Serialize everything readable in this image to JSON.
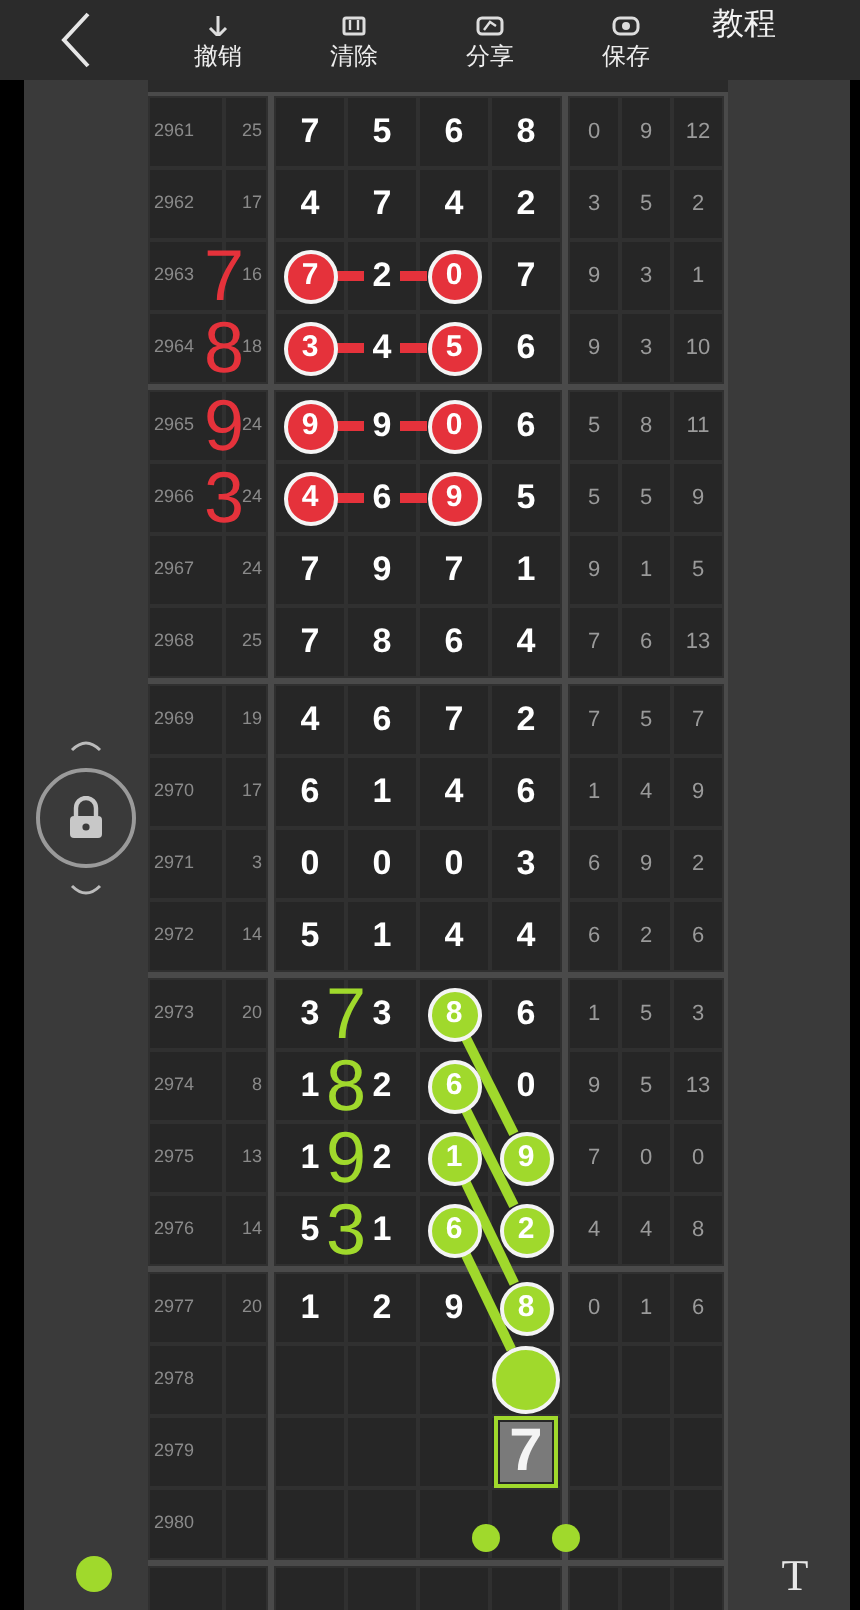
{
  "toolbar": {
    "actions": [
      {
        "label": "撤销",
        "kind": "undo"
      },
      {
        "label": "清除",
        "kind": "clear"
      },
      {
        "label": "分享",
        "kind": "share"
      },
      {
        "label": "保存",
        "kind": "save"
      }
    ],
    "help": "教程"
  },
  "rows": [
    {
      "period": "2961",
      "sum": "25",
      "digits": [
        "7",
        "5",
        "6",
        "8"
      ],
      "stats": [
        "0",
        "9",
        "12"
      ]
    },
    {
      "period": "2962",
      "sum": "17",
      "digits": [
        "4",
        "7",
        "4",
        "2"
      ],
      "stats": [
        "3",
        "5",
        "2"
      ]
    },
    {
      "period": "2963",
      "sum": "16",
      "digits": [
        {
          "v": "7",
          "color": "#e5323b",
          "kind": "across"
        },
        "2",
        {
          "v": "0",
          "color": "#e5323b",
          "kind": "end"
        },
        "7"
      ],
      "stats": [
        "9",
        "3",
        "1"
      ],
      "note": {
        "text": "7",
        "color": "#e5323b",
        "kind": "outside"
      }
    },
    {
      "period": "2964",
      "sum": "18",
      "digits": [
        {
          "v": "3",
          "color": "#e5323b",
          "kind": "across"
        },
        "4",
        {
          "v": "5",
          "color": "#e5323b",
          "kind": "end"
        },
        "6"
      ],
      "stats": [
        "9",
        "3",
        "10"
      ],
      "note": {
        "text": "8",
        "color": "#e5323b",
        "kind": "outside"
      }
    },
    {
      "period": "2965",
      "sum": "24",
      "digits": [
        {
          "v": "9",
          "color": "#e5323b",
          "kind": "across"
        },
        "9",
        {
          "v": "0",
          "color": "#e5323b",
          "kind": "end"
        },
        "6"
      ],
      "stats": [
        "5",
        "8",
        "11"
      ],
      "note": {
        "text": "9",
        "color": "#e5323b",
        "kind": "outside"
      }
    },
    {
      "period": "2966",
      "sum": "24",
      "digits": [
        {
          "v": "4",
          "color": "#e5323b",
          "kind": "across"
        },
        "6",
        {
          "v": "9",
          "color": "#e5323b",
          "kind": "end"
        },
        "5"
      ],
      "stats": [
        "5",
        "5",
        "9"
      ],
      "note": {
        "text": "3",
        "color": "#e5323b",
        "kind": "outside"
      }
    },
    {
      "period": "2967",
      "sum": "24",
      "digits": [
        "7",
        "9",
        "7",
        "1"
      ],
      "stats": [
        "9",
        "1",
        "5"
      ]
    },
    {
      "period": "2968",
      "sum": "25",
      "digits": [
        "7",
        "8",
        "6",
        "4"
      ],
      "stats": [
        "7",
        "6",
        "13"
      ]
    },
    {
      "period": "2969",
      "sum": "19",
      "digits": [
        "4",
        "6",
        "7",
        "2"
      ],
      "stats": [
        "7",
        "5",
        "7"
      ]
    },
    {
      "period": "2970",
      "sum": "17",
      "digits": [
        "6",
        "1",
        "4",
        "6"
      ],
      "stats": [
        "1",
        "4",
        "9"
      ]
    },
    {
      "period": "2971",
      "sum": "3",
      "digits": [
        "0",
        "0",
        "0",
        "3"
      ],
      "stats": [
        "6",
        "9",
        "2"
      ]
    },
    {
      "period": "2972",
      "sum": "14",
      "digits": [
        "5",
        "1",
        "4",
        "4"
      ],
      "stats": [
        "6",
        "2",
        "6"
      ]
    },
    {
      "period": "2973",
      "sum": "20",
      "digits": [
        "3",
        "3",
        {
          "v": "8",
          "color": "#a0d92c",
          "kind": "diagonal"
        },
        "6"
      ],
      "stats": [
        "1",
        "5",
        "3"
      ],
      "note": {
        "text": "7",
        "color": "#a0d92c",
        "kind": "inside"
      }
    },
    {
      "period": "2974",
      "sum": "8",
      "digits": [
        "1",
        "2",
        {
          "v": "6",
          "color": "#a0d92c",
          "kind": "diagonal"
        },
        "0"
      ],
      "stats": [
        "9",
        "5",
        "13"
      ],
      "note": {
        "text": "8",
        "color": "#a0d92c",
        "kind": "inside"
      }
    },
    {
      "period": "2975",
      "sum": "13",
      "digits": [
        "1",
        "2",
        {
          "v": "1",
          "color": "#a0d92c",
          "kind": "diagonal"
        },
        {
          "v": "9",
          "color": "#a0d92c",
          "kind": "end"
        }
      ],
      "stats": [
        "7",
        "0",
        "0"
      ],
      "note": {
        "text": "9",
        "color": "#a0d92c",
        "kind": "inside"
      }
    },
    {
      "period": "2976",
      "sum": "14",
      "digits": [
        "5",
        "1",
        {
          "v": "6",
          "color": "#a0d92c",
          "kind": "diagonal"
        },
        {
          "v": "2",
          "color": "#a0d92c",
          "kind": "end"
        }
      ],
      "stats": [
        "4",
        "4",
        "8"
      ],
      "note": {
        "text": "3",
        "color": "#a0d92c",
        "kind": "inside"
      }
    },
    {
      "period": "2977",
      "sum": "20",
      "digits": [
        "1",
        "2",
        "9",
        {
          "v": "8",
          "color": "#a0d92c",
          "kind": "end"
        }
      ],
      "stats": [
        "0",
        "1",
        "6"
      ]
    },
    {
      "period": "2978",
      "marker": {
        "color": "#a0d92c"
      }
    },
    {
      "period": "2979",
      "guess": {
        "v": "7",
        "color": "#a0d92c"
      }
    },
    {
      "period": "2980"
    }
  ],
  "pen": {
    "color": "#a0d92c"
  },
  "text_tool": "T"
}
